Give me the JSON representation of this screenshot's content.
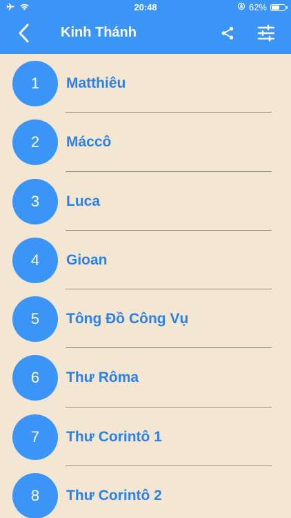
{
  "status_bar": {
    "time": "20:48",
    "battery_text": "62%",
    "battery_level": 0.62,
    "icons": [
      "airplane-icon",
      "wifi-icon",
      "orientation-lock-icon",
      "battery-icon"
    ]
  },
  "nav": {
    "title": "Kinh Thánh",
    "icons": [
      "back-chevron-icon",
      "share-icon",
      "sliders-icon"
    ]
  },
  "colors": {
    "header_bg": "#3b95f6",
    "circle_bg": "#3b95f6",
    "item_text": "#2b82e6",
    "page_bg": "#f3e6d2"
  },
  "books": [
    {
      "number": "1",
      "name": "Matthiêu"
    },
    {
      "number": "2",
      "name": "Máccô"
    },
    {
      "number": "3",
      "name": "Luca"
    },
    {
      "number": "4",
      "name": "Gioan"
    },
    {
      "number": "5",
      "name": "Tông Đồ Công Vụ"
    },
    {
      "number": "6",
      "name": "Thư Rôma"
    },
    {
      "number": "7",
      "name": "Thư Corintô 1"
    },
    {
      "number": "8",
      "name": "Thư Corintô 2"
    }
  ]
}
